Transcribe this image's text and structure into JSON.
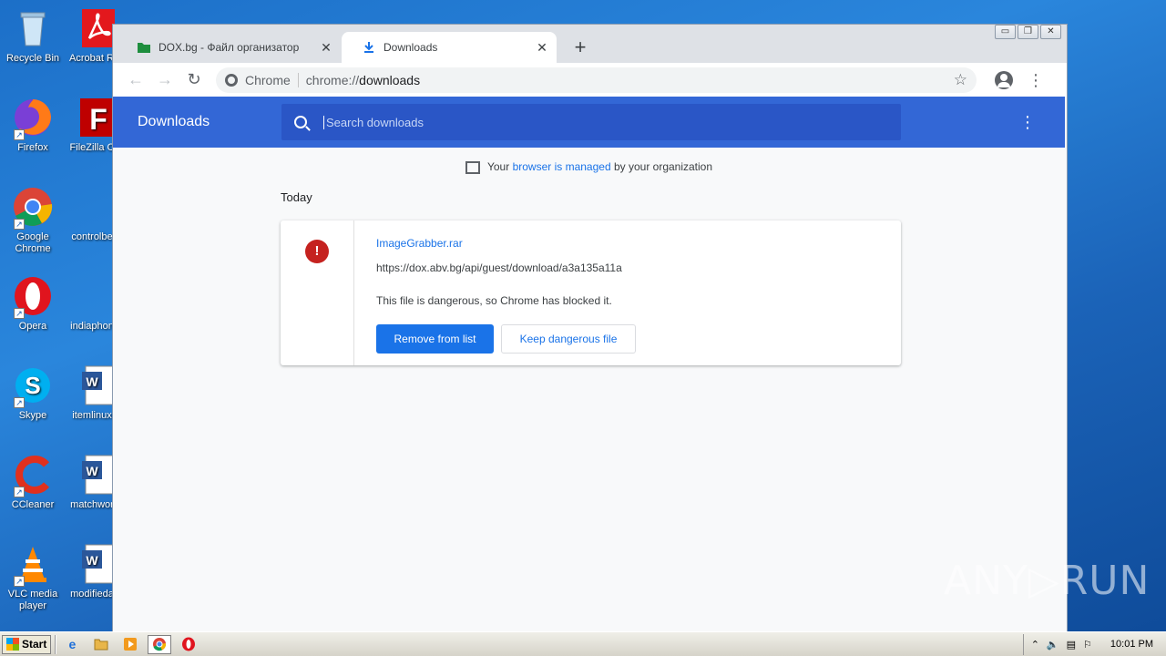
{
  "desktop": {
    "icons_col1": [
      {
        "label": "Recycle Bin",
        "icon": "recycle-bin-icon"
      },
      {
        "label": "Firefox",
        "icon": "firefox-icon"
      },
      {
        "label": "Google Chrome",
        "icon": "chrome-icon"
      },
      {
        "label": "Opera",
        "icon": "opera-icon"
      },
      {
        "label": "Skype",
        "icon": "skype-icon"
      },
      {
        "label": "CCleaner",
        "icon": "ccleaner-icon"
      },
      {
        "label": "VLC media player",
        "icon": "vlc-icon"
      }
    ],
    "icons_col2": [
      {
        "label": "Acrobat Reader",
        "icon": "acrobat-icon"
      },
      {
        "label": "FileZilla C",
        "icon": "filezilla-icon"
      },
      {
        "label": "controlbe",
        "icon": "blank-icon"
      },
      {
        "label": "indiaphon",
        "icon": "blank-icon"
      },
      {
        "label": "itemlinux",
        "icon": "word-doc-icon"
      },
      {
        "label": "matchwor",
        "icon": "word-doc-icon"
      },
      {
        "label": "modifieda",
        "icon": "word-doc-icon"
      }
    ]
  },
  "window": {
    "controls": {
      "minimize": "▭",
      "restore": "❐",
      "close": "✕"
    }
  },
  "tabs": [
    {
      "title": "DOX.bg - Файл организатор",
      "close": "✕"
    },
    {
      "title": "Downloads",
      "close": "✕"
    }
  ],
  "new_tab_label": "+",
  "toolbar": {
    "back": "←",
    "forward": "→",
    "reload": "↻",
    "omnibox_scheme": "Chrome",
    "omnibox_url_prefix": "chrome://",
    "omnibox_url_host": "downloads",
    "star": "☆",
    "menu": "⋮"
  },
  "downloads_page": {
    "title": "Downloads",
    "search_placeholder": "Search downloads",
    "menu": "⋮",
    "managed_prefix": "Your ",
    "managed_link": "browser is managed",
    "managed_suffix": " by your organization",
    "date_heading": "Today",
    "item": {
      "danger_glyph": "!",
      "file_name": "ImageGrabber.rar",
      "url": "https://dox.abv.bg/api/guest/download/a3a135a11a",
      "description": "This file is dangerous, so Chrome has blocked it.",
      "remove_button": "Remove from list",
      "keep_button": "Keep dangerous file"
    }
  },
  "watermark": "ANY▷RUN",
  "taskbar": {
    "start_label": "Start",
    "clock": "10:01 PM",
    "tray_icons": [
      "network-icon",
      "speaker-icon",
      "printer-icon",
      "flag-icon"
    ]
  },
  "colors": {
    "header_blue": "#3367d6",
    "link_blue": "#1a73e8",
    "danger_red": "#c5221f"
  }
}
